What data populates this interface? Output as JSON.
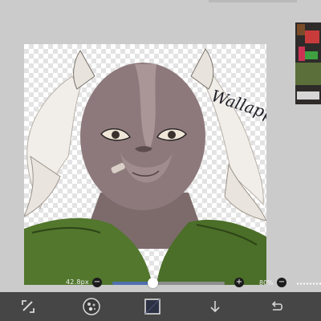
{
  "brush": {
    "size_label": "42.8px",
    "opacity_label": "80%",
    "slider_value_percent": 36,
    "minus_symbol": "−",
    "plus_symbol": "+"
  },
  "artwork": {
    "signature_text": "Wallapple"
  },
  "toolbar": {
    "items": [
      {
        "name": "transform-tool",
        "icon": "transform-icon"
      },
      {
        "name": "brush-preview",
        "icon": "brush-texture-icon"
      },
      {
        "name": "color-swatch",
        "icon": "color-square-icon"
      },
      {
        "name": "download-button",
        "icon": "arrow-down-icon"
      },
      {
        "name": "undo-button",
        "icon": "undo-arrow-icon"
      }
    ]
  },
  "colors": {
    "background": "#cbcbcb",
    "toolbar": "#464646",
    "slider_active": "#4f6fb3",
    "color_swatch": "#2c3144"
  }
}
